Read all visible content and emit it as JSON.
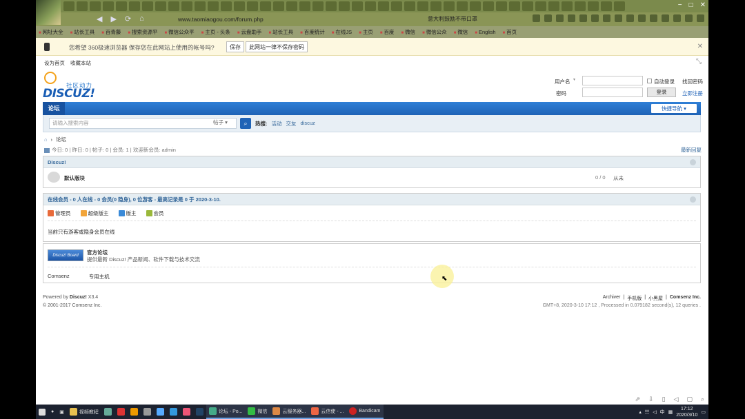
{
  "browser": {
    "url": "www.taomiaogou.com/forum.php",
    "promo": "意大利鼓励不带口罩",
    "bookmarks": [
      "网址大全",
      "站长工具",
      "百青藤",
      "搜索资源平",
      "微信公众平",
      "主页 - 头条",
      "云盘助手",
      "站长工具",
      "百度统计",
      "在线JS",
      "主页",
      "百度",
      "微信",
      "微信公众",
      "微信",
      "English",
      "首页"
    ],
    "window_controls": [
      "−",
      "□",
      "✕"
    ]
  },
  "password_bar": {
    "message": "您希望 360极速浏览器 保存您在此网站上使用的帐号吗?",
    "save_label": "保存",
    "never_label": "此网站一律不保存密码",
    "close": "✕"
  },
  "page": {
    "top_links": [
      "设为首页",
      "收藏本站"
    ],
    "logo": {
      "tagline": "社区动力",
      "brand": "DISCUZ!"
    },
    "login": {
      "username_label": "用户名",
      "password_label": "密码",
      "auto_login": "自动登录",
      "find_password": "找回密码",
      "login_button": "登录",
      "register": "立即注册"
    },
    "nav": {
      "current": "论坛",
      "quick_nav": "快捷导航 ▾"
    },
    "search": {
      "placeholder": "请输入搜索内容",
      "type": "帖子 ▾",
      "hot_label": "热搜:",
      "hot_terms": [
        "活动",
        "交友",
        "discuz"
      ]
    },
    "breadcrumb": {
      "sep": "›",
      "current": "论坛"
    },
    "stats": "今日: 0 | 昨日: 0 | 帖子: 0 | 会员: 1 | 欢迎新会员: admin",
    "newest_reply": "最新回复",
    "category": {
      "title": "Discuz!",
      "forum_name": "默认版块",
      "counts": "0 / 0",
      "last_post": "从未"
    },
    "online": {
      "title": "在线会员 - 0 人在线 - 0 会员(0 隐身), 0 位游客 - 最高记录是 0 于 2020-3-10.",
      "legend": [
        {
          "label": "管理员",
          "color": "#e86a3a"
        },
        {
          "label": "超级版主",
          "color": "#f2a53a"
        },
        {
          "label": "版主",
          "color": "#3a8ad8"
        },
        {
          "label": "会员",
          "color": "#9ab83a"
        }
      ],
      "note": "当前只有游客或隐身会员在线"
    },
    "links": {
      "banner": "Discuz! Board",
      "title": "官方论坛",
      "desc": "提供最新 Discuz! 产品新闻、软件下载与技术交流",
      "bottom": [
        "Comsenz",
        "专用主机"
      ]
    },
    "footer": {
      "powered": "Powered by",
      "powered_by": "Discuz!",
      "version": "X3.4",
      "copyright": "© 2001-2017 Comsenz Inc.",
      "links": [
        "Archiver",
        "手机版",
        "小黑屋"
      ],
      "company": "Comsenz Inc.",
      "timing": "GMT+8, 2020-3-10 17:12 , Processed in 0.079182 second(s), 12 queries ."
    }
  },
  "taskbar": {
    "apps": [
      "视频教程",
      "论坛 - Po...",
      "微信",
      "云服务器...",
      "云信使 - ...",
      "Bandicam"
    ],
    "ime": "中",
    "time": "17:12",
    "date": "2020/3/10"
  }
}
